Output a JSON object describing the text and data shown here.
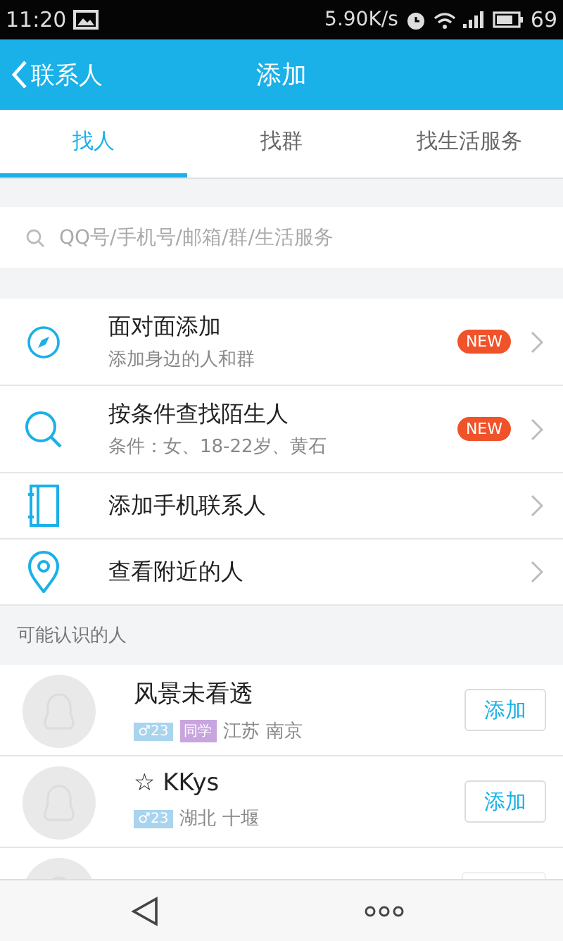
{
  "status_bar": {
    "time": "11:20",
    "speed": "5.90K/s",
    "battery": "69"
  },
  "header": {
    "back": "联系人",
    "title": "添加"
  },
  "tabs": [
    {
      "label": "找人",
      "selected": true
    },
    {
      "label": "找群",
      "selected": false
    },
    {
      "label": "找生活服务",
      "selected": false
    }
  ],
  "search": {
    "placeholder": "QQ号/手机号/邮箱/群/生活服务"
  },
  "menu": [
    {
      "kind": "compass",
      "title": "面对面添加",
      "subtitle": "添加身边的人和群",
      "badge": "NEW"
    },
    {
      "kind": "search",
      "title": "按条件查找陌生人",
      "subtitle": "条件：女、18-22岁、黄石",
      "badge": "NEW"
    },
    {
      "kind": "contacts",
      "title": "添加手机联系人"
    },
    {
      "kind": "location",
      "title": "查看附近的人"
    }
  ],
  "people_section": {
    "title": "可能认识的人",
    "people": [
      {
        "name": "风景未看透",
        "tags": [
          {
            "text": "♂23",
            "color": "#a8d4ee"
          },
          {
            "text": "同学",
            "color": "#c8a5de"
          }
        ],
        "location": "江苏 南京",
        "button": "添加"
      },
      {
        "name": "☆  KKys",
        "tags": [
          {
            "text": "♂23",
            "color": "#a8d4ee"
          }
        ],
        "location": "湖北 十堰",
        "button": "添加"
      },
      {
        "kind": "clipped"
      }
    ]
  }
}
